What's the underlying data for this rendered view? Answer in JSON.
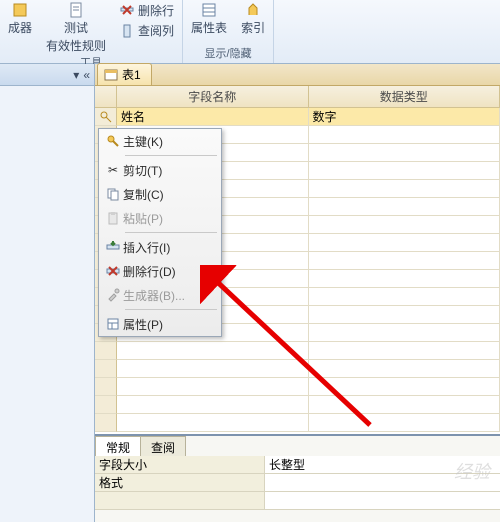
{
  "ribbon": {
    "group_tools": {
      "label": "工具",
      "builder": "成器",
      "test": "测试",
      "validation": "有效性规则",
      "delete_row": "删除行",
      "lookup": "查阅列"
    },
    "group_showhide": {
      "label": "显示/隐藏",
      "property_sheet": "属性表",
      "indexes": "索引"
    }
  },
  "tab": {
    "title": "表1"
  },
  "columns": {
    "field_name": "字段名称",
    "data_type": "数据类型"
  },
  "rows": [
    {
      "name": "姓名",
      "type": "数字"
    }
  ],
  "context_menu": {
    "primary_key": "主键(K)",
    "cut": "剪切(T)",
    "copy": "复制(C)",
    "paste": "粘贴(P)",
    "insert_row": "插入行(I)",
    "delete_row": "删除行(D)",
    "builder": "生成器(B)...",
    "properties": "属性(P)"
  },
  "props": {
    "tab_general": "常规",
    "tab_lookup": "查阅",
    "field_size_label": "字段大小",
    "field_size_value": "长整型",
    "format_label": "格式"
  },
  "watermark": "经验"
}
